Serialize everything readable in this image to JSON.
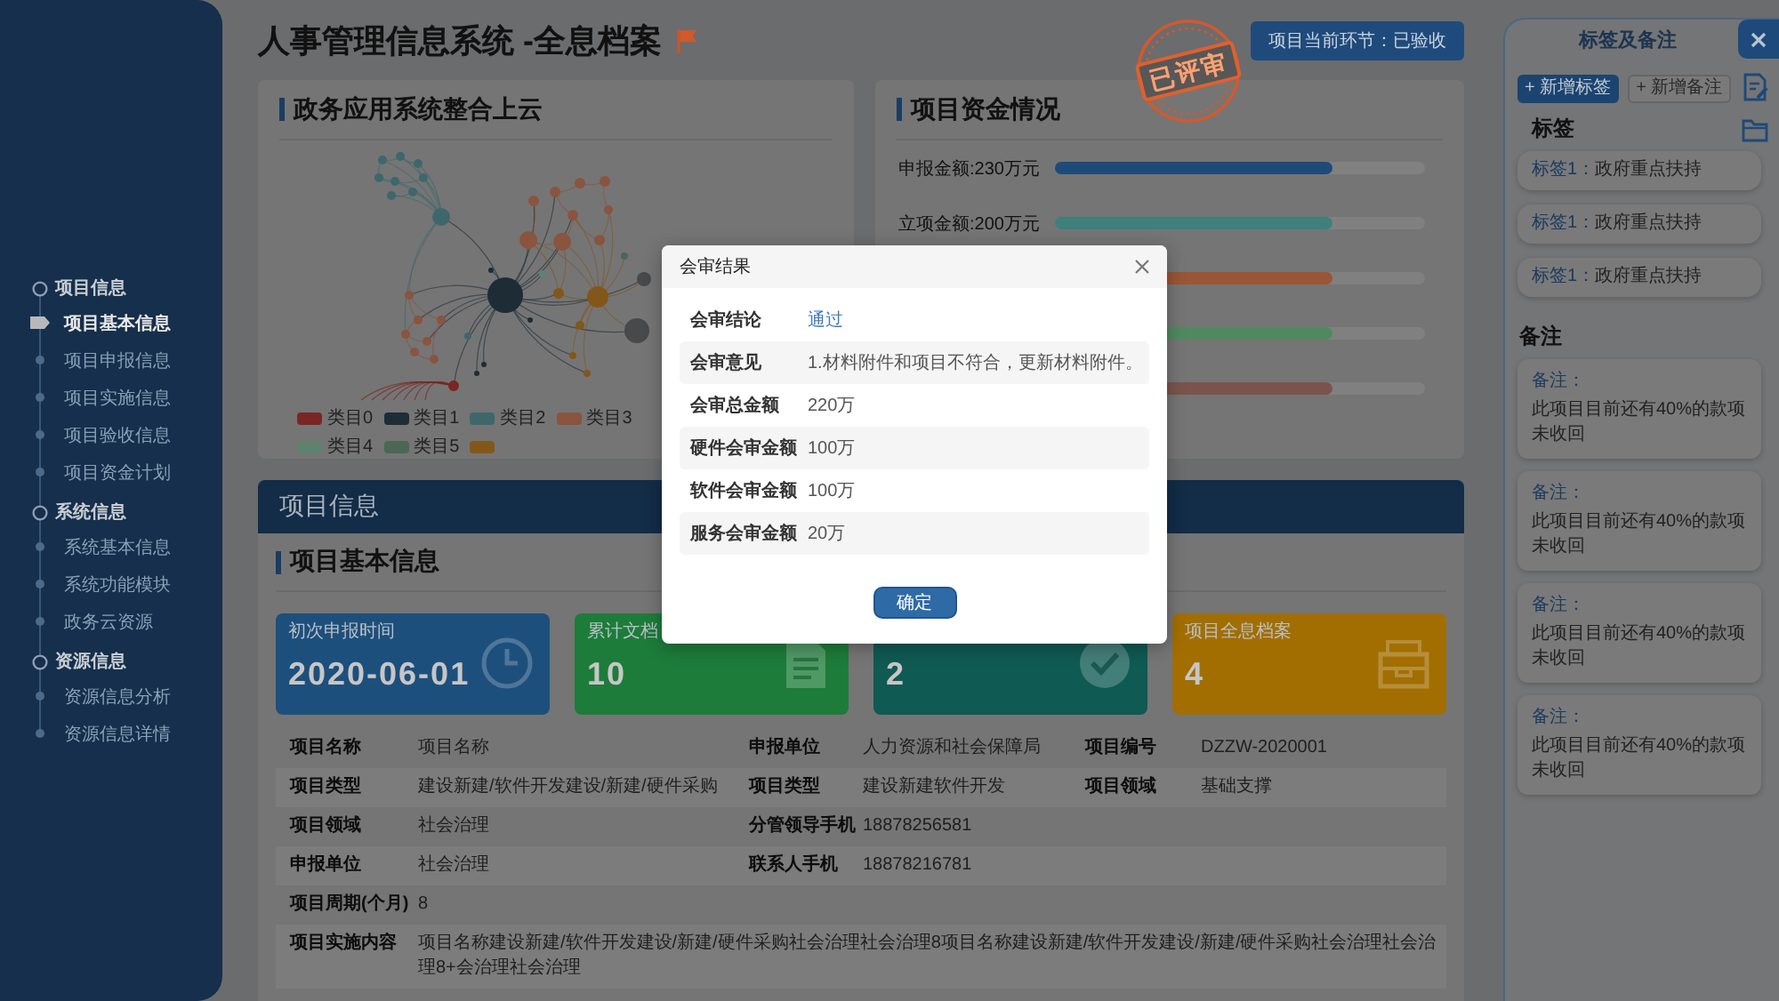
{
  "sidebar": {
    "groups": [
      {
        "label": "项目信息",
        "children": [
          {
            "label": "项目基本信息",
            "selected": true
          },
          {
            "label": "项目申报信息",
            "selected": false
          },
          {
            "label": "项目实施信息",
            "selected": false
          },
          {
            "label": "项目验收信息",
            "selected": false
          },
          {
            "label": "项目资金计划",
            "selected": false
          }
        ]
      },
      {
        "label": "系统信息",
        "children": [
          {
            "label": "系统基本信息",
            "selected": false
          },
          {
            "label": "系统功能模块",
            "selected": false
          },
          {
            "label": "政务云资源",
            "selected": false
          }
        ]
      },
      {
        "label": "资源信息",
        "children": [
          {
            "label": "资源信息分析",
            "selected": false
          },
          {
            "label": "资源信息详情",
            "selected": false
          }
        ]
      }
    ]
  },
  "header": {
    "title": "人事管理信息系统 -全息档案",
    "status_button": "项目当前环节：已验收",
    "stamp": "已评审"
  },
  "graph_card": {
    "title": "政务应用系统整合上云",
    "legend": [
      {
        "label": "类目0",
        "color": "#7a2624"
      },
      {
        "label": "类目1",
        "color": "#1e2c36"
      },
      {
        "label": "类目2",
        "color": "#3e676c"
      },
      {
        "label": "类目3",
        "color": "#8a543f"
      },
      {
        "label": "类目4",
        "color": "#5e8170"
      },
      {
        "label": "类目5",
        "color": "#4b6755"
      },
      {
        "color": "#83571a"
      }
    ]
  },
  "funding_card": {
    "title": "项目资金情况",
    "items": [
      {
        "label": "申报金额:230万元",
        "level": 0.75,
        "color": "#1e4a7a"
      },
      {
        "label": "立项金额:200万元",
        "level": 0.75,
        "color": "#3e807a"
      },
      {
        "level": 0.75,
        "color": "#9a5536"
      },
      {
        "level": 0.75,
        "color": "#4f8a5f"
      },
      {
        "level": 0.75,
        "color": "#7a544c"
      }
    ]
  },
  "project_info": {
    "banner": "项目信息",
    "section_title": "项目基本信息",
    "stats": [
      {
        "label": "初次申报时间",
        "value": "2020-06-01",
        "color": "#1d4f7d"
      },
      {
        "label": "累计文档",
        "value": "10",
        "color": "#1d7c3a"
      },
      {
        "value": "2",
        "color": "#0f5a52"
      },
      {
        "label": "项目全息档案",
        "value": "4",
        "color": "#a26e02"
      }
    ],
    "rows": [
      [
        {
          "label": "项目名称",
          "value": "项目名称"
        },
        {
          "label": "申报单位",
          "value": "人力资源和社会保障局"
        },
        {
          "label": "项目编号",
          "value": "DZZW-2020001"
        }
      ],
      [
        {
          "label": "项目类型",
          "value": "建设新建/软件开发建设/新建/硬件采购"
        },
        {
          "label": "项目类型",
          "value": "建设新建软件开发"
        },
        {
          "label": "项目领域",
          "value": "基础支撑"
        }
      ],
      [
        {
          "label": "项目领域",
          "value": "社会治理"
        },
        {
          "label": "分管领导手机",
          "value": "18878256581"
        }
      ],
      [
        {
          "label": "申报单位",
          "value": "社会治理"
        },
        {
          "label": "联系人手机",
          "value": "18878216781"
        }
      ],
      [
        {
          "label": "项目周期(个月)",
          "value": "8"
        }
      ],
      [
        {
          "label": "项目实施内容",
          "value": "项目名称建设新建/软件开发建设/新建/硬件采购社会治理社会治理8项目名称建设新建/软件开发建设/新建/硬件采购社会治理社会治理8+会治理社会治理"
        }
      ]
    ]
  },
  "side_panel": {
    "title": "标签及备注",
    "buttons": [
      {
        "label": "+ 新增标签",
        "primary": true
      },
      {
        "label": "+ 新增备注",
        "primary": false
      }
    ],
    "tags_heading": "标签",
    "tags": [
      {
        "key": "标签1：",
        "value": "政府重点扶持"
      },
      {
        "key": "标签1：",
        "value": "政府重点扶持"
      },
      {
        "key": "标签1：",
        "value": "政府重点扶持"
      }
    ],
    "notes_heading": "备注",
    "notes": [
      {
        "key": "备注：",
        "text": "此项目目前还有40%的款项未收回"
      },
      {
        "key": "备注：",
        "text": "此项目目前还有40%的款项未收回"
      },
      {
        "key": "备注：",
        "text": "此项目目前还有40%的款项未收回"
      },
      {
        "key": "备注：",
        "text": "此项目目前还有40%的款项未收回"
      }
    ]
  },
  "modal": {
    "title": "会审结果",
    "rows": [
      {
        "label": "会审结论",
        "value": "通过",
        "kind": "link"
      },
      {
        "label": "会审意见",
        "value": "1.材料附件和项目不符合，更新材料附件。",
        "kind": "text"
      },
      {
        "label": "会审总金额",
        "value": "220万",
        "kind": "text"
      },
      {
        "label": "硬件会审金额",
        "value": "100万",
        "kind": "text"
      },
      {
        "label": "软件会审金额",
        "value": "100万",
        "kind": "text"
      },
      {
        "label": "服务会审金额",
        "value": "20万",
        "kind": "text"
      }
    ],
    "confirm": "确定"
  }
}
